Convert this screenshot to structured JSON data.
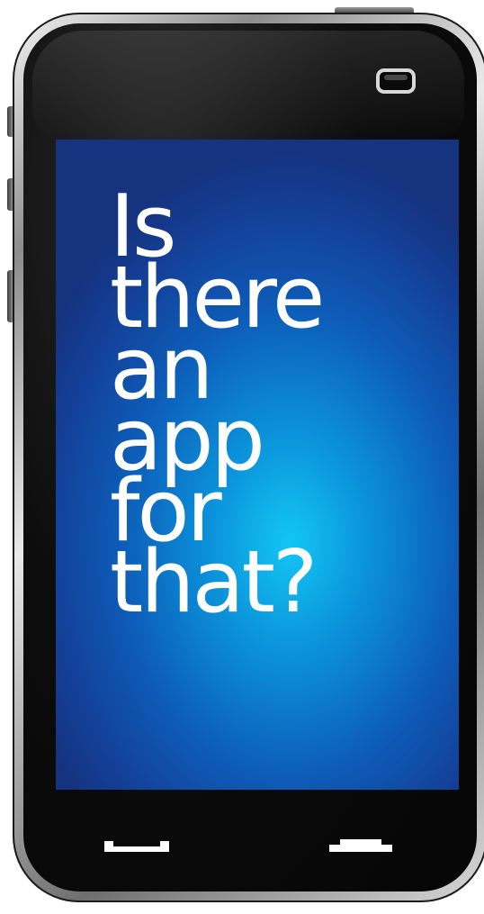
{
  "screen": {
    "headline_lines": [
      "Is",
      "there",
      "an",
      "app",
      "for",
      "that?"
    ]
  },
  "icons": {
    "camera": "camera-icon",
    "call": "call-icon",
    "end_call": "end-call-icon"
  },
  "colors": {
    "phone_body": "#0a0a0a",
    "screen_center": "#12c6f4",
    "screen_edge": "#15337f",
    "text": "#ffffff"
  }
}
